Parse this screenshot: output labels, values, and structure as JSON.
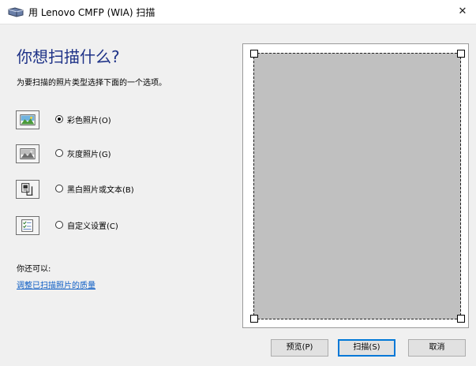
{
  "window": {
    "title": "用 Lenovo CMFP (WIA) 扫描",
    "close_glyph": "✕"
  },
  "heading": "你想扫描什么?",
  "instruction": "为要扫描的照片类型选择下面的一个选项。",
  "options": [
    {
      "label": "彩色照片(O)",
      "selected": true,
      "icon": "color-photo-icon"
    },
    {
      "label": "灰度照片(G)",
      "selected": false,
      "icon": "grayscale-photo-icon"
    },
    {
      "label": "黑白照片或文本(B)",
      "selected": false,
      "icon": "bw-text-icon"
    },
    {
      "label": "自定义设置(C)",
      "selected": false,
      "icon": "custom-settings-icon"
    }
  ],
  "also_text": "你还可以:",
  "quality_link": "调整已扫描照片的质量",
  "buttons": {
    "preview": "预览(P)",
    "scan": "扫描(S)",
    "cancel": "取消"
  },
  "colors": {
    "heading": "#1e3287",
    "link": "#0b5cc4",
    "preview_fill": "#c0c0c0",
    "default_button_border": "#0078d7"
  }
}
